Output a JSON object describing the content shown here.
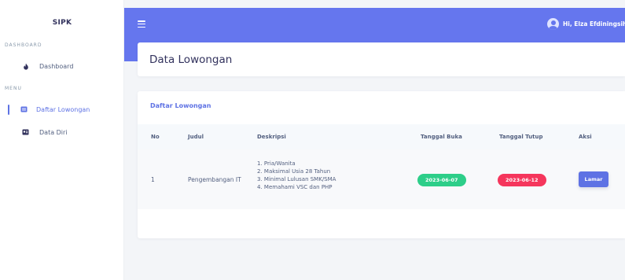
{
  "app": {
    "brand": "SIPK"
  },
  "sidebar": {
    "sections": [
      {
        "label": "DASHBOARD",
        "items": [
          {
            "label": "Dashboard",
            "icon": "flame-icon",
            "active": false
          }
        ]
      },
      {
        "label": "MENU",
        "items": [
          {
            "label": "Daftar Lowongan",
            "icon": "list-icon",
            "active": true
          },
          {
            "label": "Data Diri",
            "icon": "id-card-icon",
            "active": false
          }
        ]
      }
    ]
  },
  "topbar": {
    "greeting": "Hi, Elza Efdiningsih"
  },
  "page": {
    "title": "Data Lowongan"
  },
  "card": {
    "title": "Daftar Lowongan",
    "columns": [
      "No",
      "Judul",
      "Deskripsi",
      "Tanggal Buka",
      "Tanggal Tutup",
      "Aksi"
    ],
    "rows": [
      {
        "no": "1",
        "judul": "Pengembangan IT",
        "deskripsi": [
          "1. Pria/Wanita",
          "2. Maksimal Usia 28 Tahun",
          "3. Minimal Lulusan SMK/SMA",
          "4. Memahami VSC dan PHP"
        ],
        "tanggal_buka": "2023-06-07",
        "tanggal_tutup": "2023-06-12",
        "aksi": "Lamar"
      }
    ]
  },
  "colors": {
    "accent": "#5e72e4",
    "topbar": "#6576ee",
    "open": "#2dce89",
    "close": "#f5365c"
  }
}
